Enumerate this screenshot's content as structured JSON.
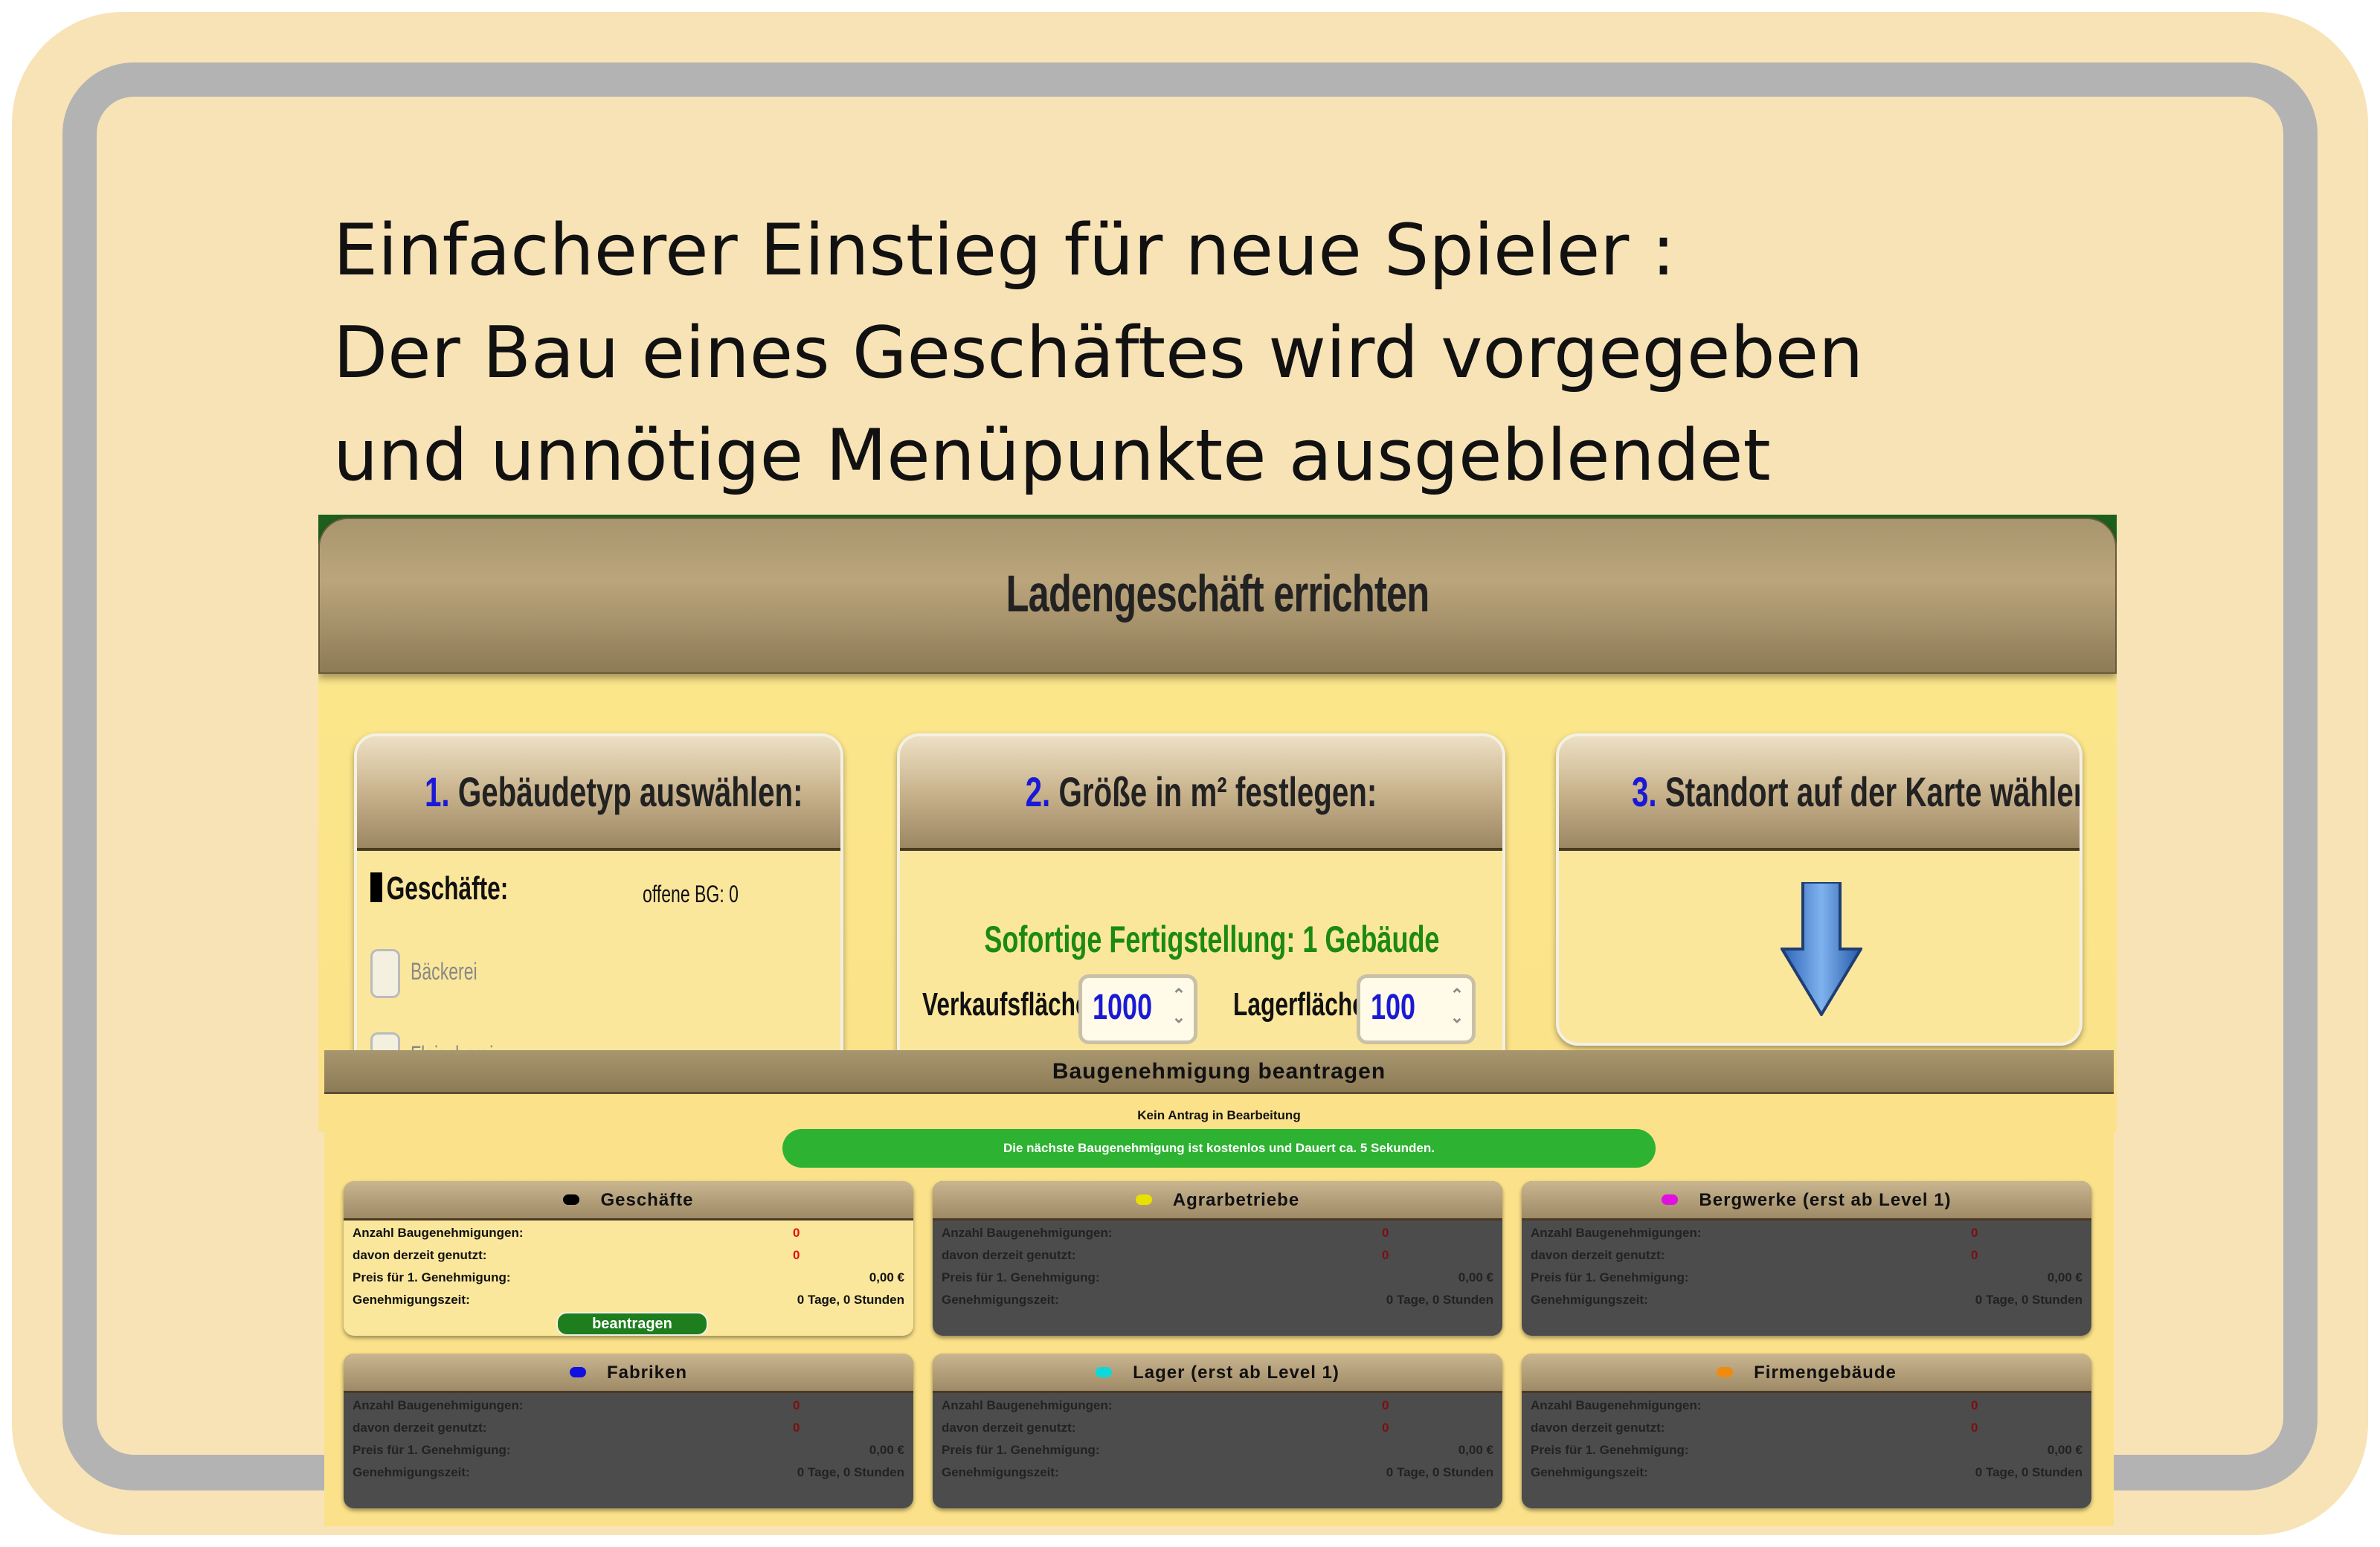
{
  "caption": {
    "line1": "Einfacherer Einstieg für neue Spieler :",
    "line2": "Der Bau eines Geschäftes wird vorgegeben",
    "line3": "und unnötige Menüpunkte ausgeblendet"
  },
  "game": {
    "title": "Ladengeschäft errichten",
    "step1": {
      "num": "1.",
      "title": "Gebäudetyp auswählen:",
      "group_label": "Geschäfte:",
      "offene_bg": "offene BG: 0",
      "option1": "Bäckerei",
      "option2": "Fleischerei"
    },
    "step2": {
      "num": "2.",
      "title": "Größe in m² festlegen:",
      "status": "Sofortige Fertigstellung: 1 Gebäude",
      "verkauf_label": "Verkaufsfläche:",
      "verkauf_value": "1000",
      "lager_label": "Lagerfläche:",
      "lager_value": "100"
    },
    "step3": {
      "num": "3.",
      "title": "Standort auf der Karte wählen:",
      "arrow_icon": "down-arrow-icon"
    }
  },
  "permit": {
    "title": "Baugenehmigung beantragen",
    "status": "Kein Antrag in Bearbeitung",
    "notice": "Die nächste Baugenehmigung ist kostenlos und Dauert ca. 5 Sekunden.",
    "row_labels": {
      "anzahl": "Anzahl Baugenehmigungen:",
      "genutzt": "davon derzeit genutzt:",
      "preis": "Preis für 1. Genehmigung:",
      "zeit": "Genehmigungszeit:"
    },
    "button_label": "beantragen",
    "cards": [
      {
        "title": "Geschäfte",
        "dot_color": "#000000",
        "anzahl": "0",
        "genutzt": "0",
        "preis": "0,00 €",
        "zeit": "0 Tage, 0 Stunden",
        "active": true
      },
      {
        "title": "Agrarbetriebe",
        "dot_color": "#e8e000",
        "anzahl": "0",
        "genutzt": "0",
        "preis": "0,00 €",
        "zeit": "0 Tage, 0 Stunden",
        "active": false
      },
      {
        "title": "Bergwerke (erst ab Level 1)",
        "dot_color": "#e010e0",
        "anzahl": "0",
        "genutzt": "0",
        "preis": "0,00 €",
        "zeit": "0 Tage, 0 Stunden",
        "active": false
      },
      {
        "title": "Fabriken",
        "dot_color": "#1010e0",
        "anzahl": "0",
        "genutzt": "0",
        "preis": "0,00 €",
        "zeit": "0 Tage, 0 Stunden",
        "active": false
      },
      {
        "title": "Lager (erst ab Level 1)",
        "dot_color": "#10d8d8",
        "anzahl": "0",
        "genutzt": "0",
        "preis": "0,00 €",
        "zeit": "0 Tage, 0 Stunden",
        "active": false
      },
      {
        "title": "Firmengebäude",
        "dot_color": "#f08a10",
        "anzahl": "0",
        "genutzt": "0",
        "preis": "0,00 €",
        "zeit": "0 Tage, 0 Stunden",
        "active": false
      }
    ]
  }
}
